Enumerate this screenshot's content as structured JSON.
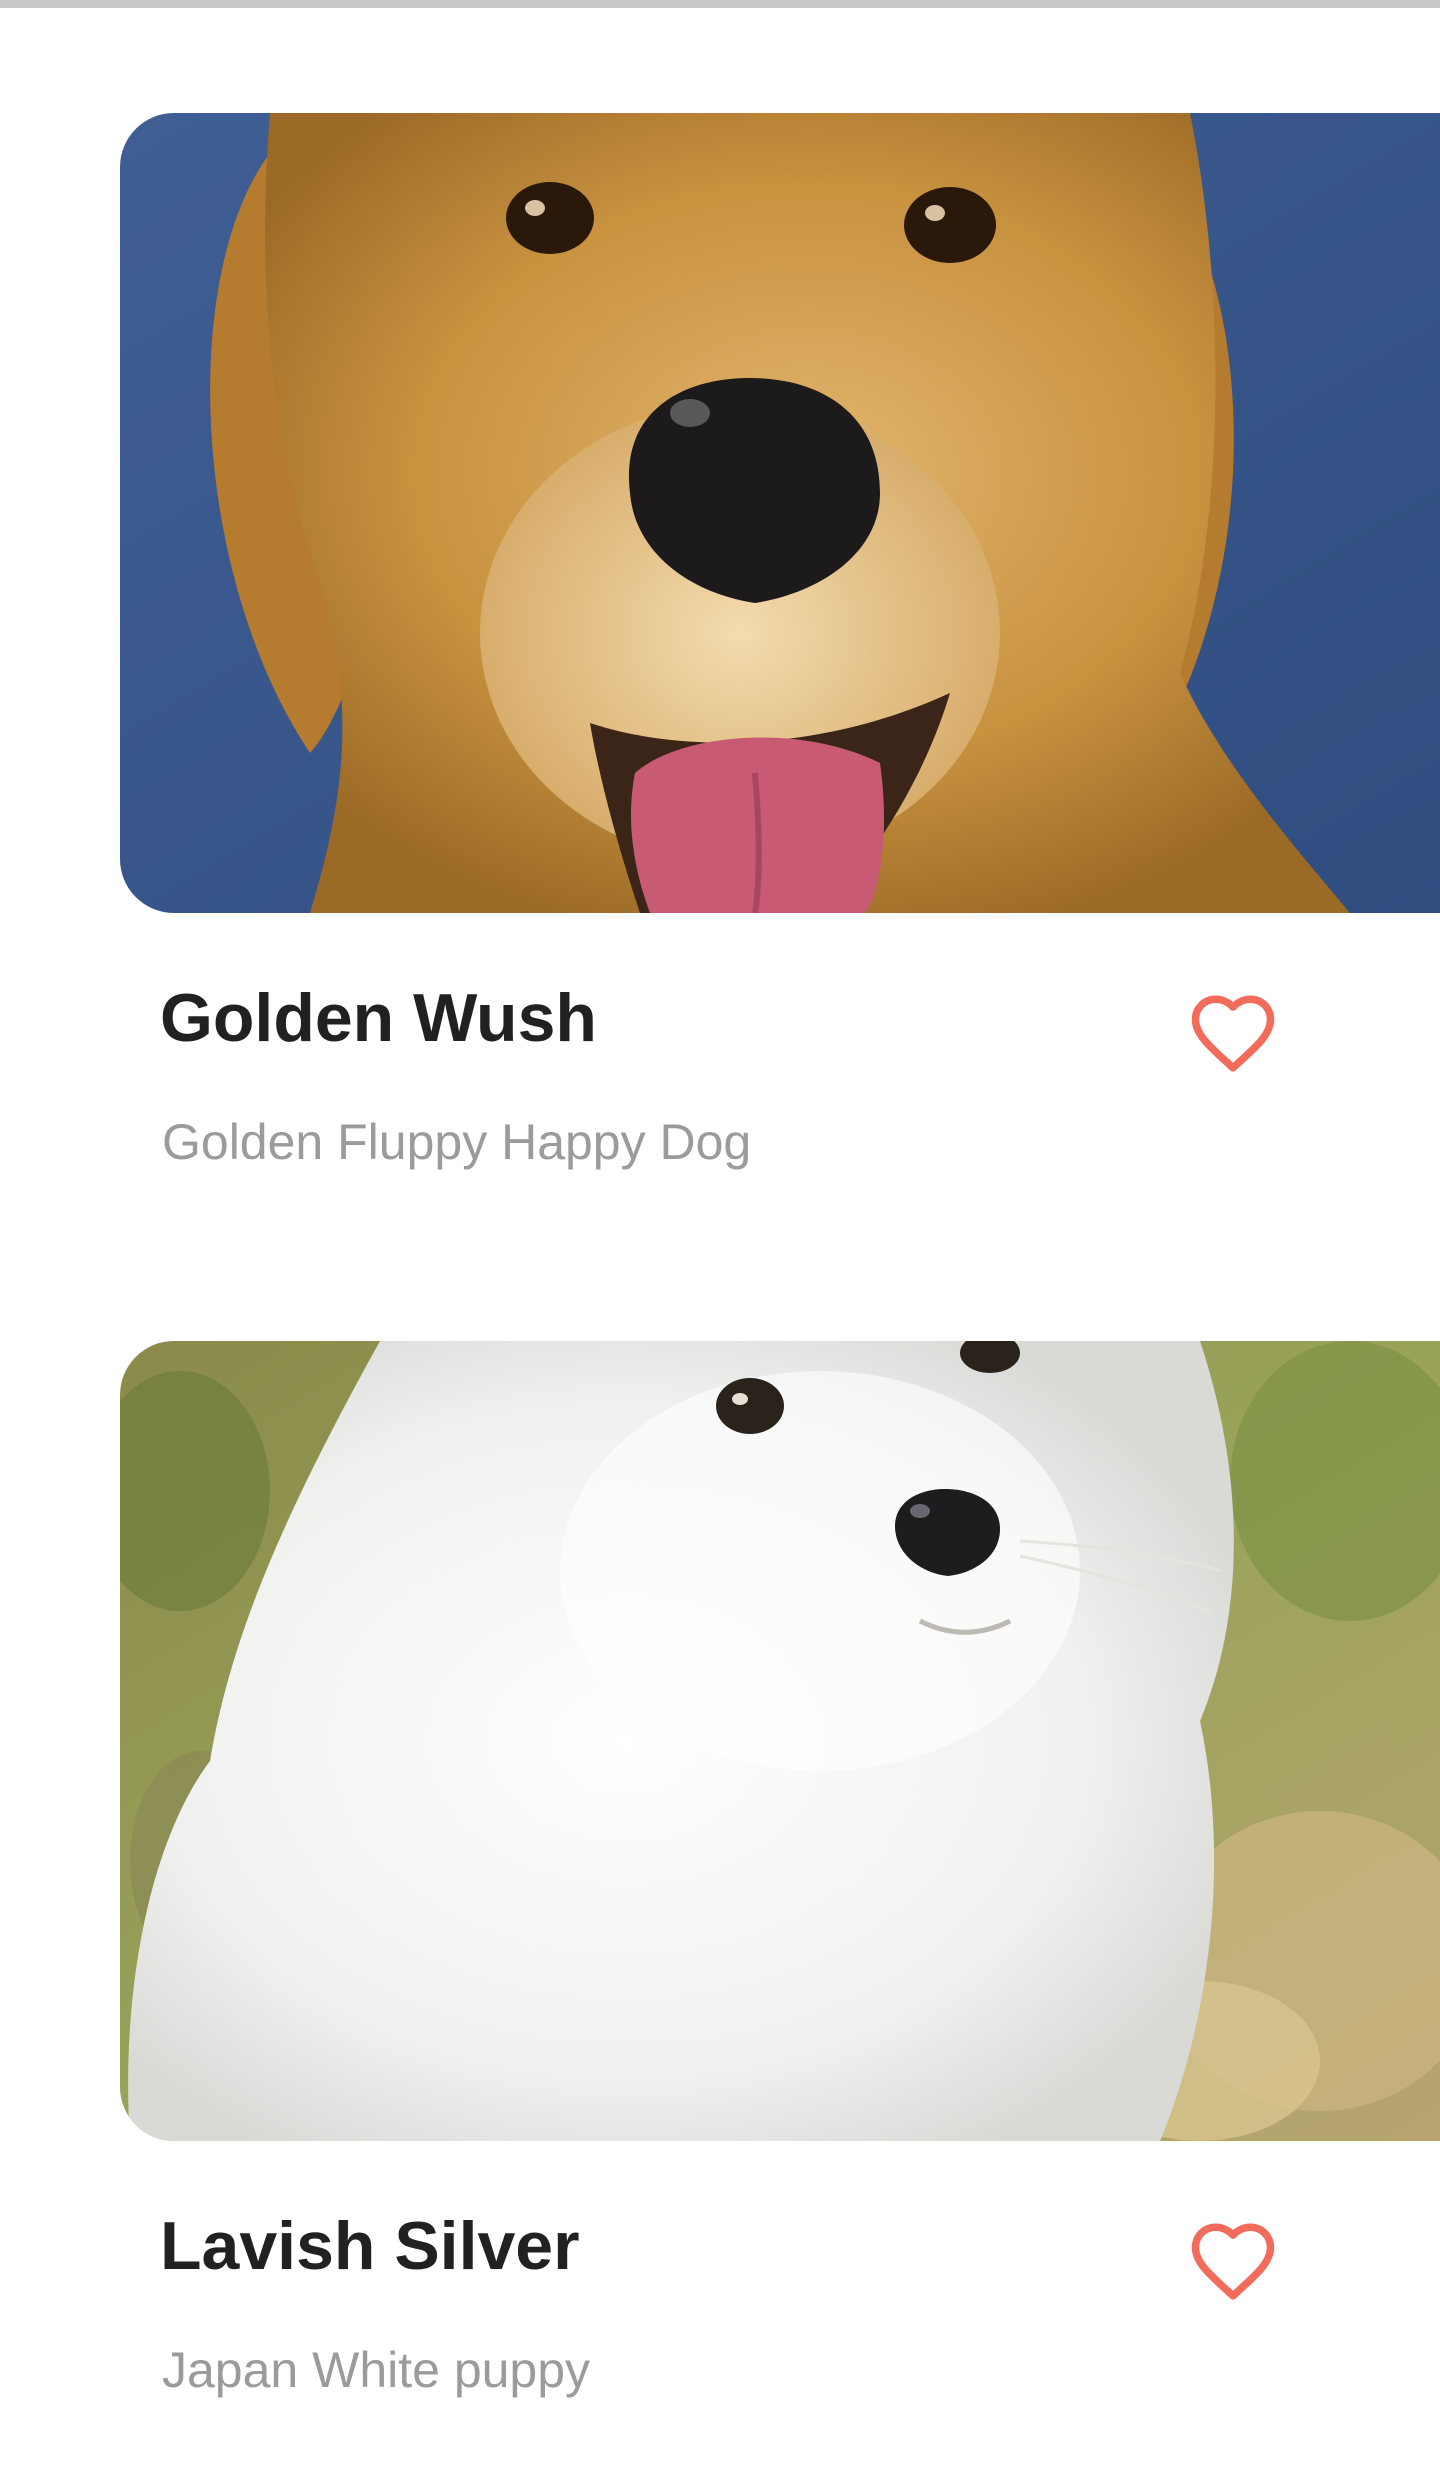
{
  "colors": {
    "accent": "#f26b5b",
    "title_text": "#212121",
    "subtitle_text": "#9b9b9b",
    "top_bar": "#c9c9c9"
  },
  "cards": [
    {
      "title": "Golden Wush",
      "subtitle": "Golden Fluppy Happy Dog",
      "favorite_icon": "heart-outline-icon",
      "photo": "golden-retriever-photo"
    },
    {
      "title": "Lavish Silver",
      "subtitle": "Japan White puppy",
      "favorite_icon": "heart-outline-icon",
      "photo": "white-spitz-puppy-photo"
    }
  ]
}
